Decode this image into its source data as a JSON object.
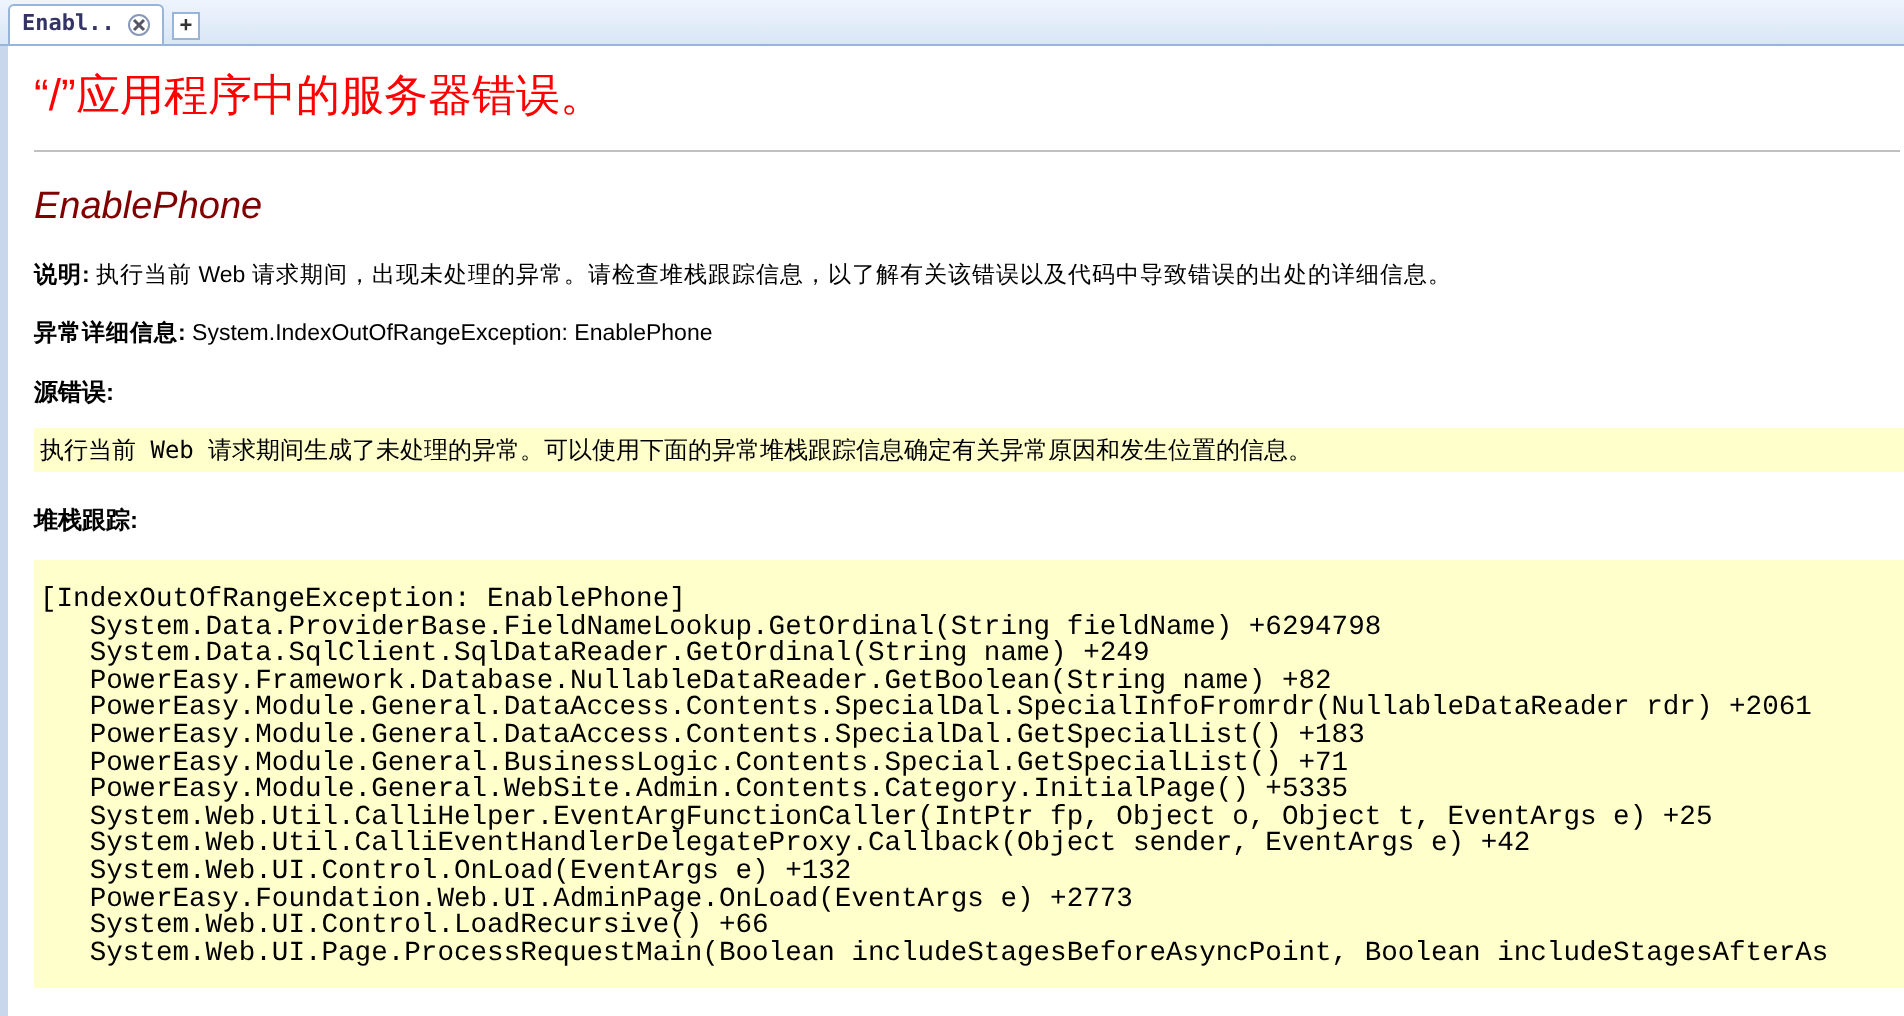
{
  "tabs": [
    {
      "label": "Enabl..",
      "selected": true
    }
  ],
  "new_tab": "+",
  "title": "“/”应用程序中的服务器错误。",
  "error_name": "EnablePhone",
  "description": {
    "label": "说明:",
    "text": "执行当前 Web 请求期间，出现未处理的异常。请检查堆栈跟踪信息，以了解有关该错误以及代码中导致错误的出处的详细信息。"
  },
  "exception_details": {
    "label": "异常详细信息:",
    "text": "System.IndexOutOfRangeException: EnablePhone"
  },
  "source_error": {
    "label": "源错误:",
    "text": "执行当前 Web 请求期间生成了未处理的异常。可以使用下面的异常堆栈跟踪信息确定有关异常原因和发生位置的信息。"
  },
  "stack_trace": {
    "label": "堆栈跟踪:",
    "lines": [
      "[IndexOutOfRangeException: EnablePhone]",
      "   System.Data.ProviderBase.FieldNameLookup.GetOrdinal(String fieldName) +6294798",
      "   System.Data.SqlClient.SqlDataReader.GetOrdinal(String name) +249",
      "   PowerEasy.Framework.Database.NullableDataReader.GetBoolean(String name) +82",
      "   PowerEasy.Module.General.DataAccess.Contents.SpecialDal.SpecialInfoFromrdr(NullableDataReader rdr) +2061",
      "   PowerEasy.Module.General.DataAccess.Contents.SpecialDal.GetSpecialList() +183",
      "   PowerEasy.Module.General.BusinessLogic.Contents.Special.GetSpecialList() +71",
      "   PowerEasy.Module.General.WebSite.Admin.Contents.Category.InitialPage() +5335",
      "   System.Web.Util.CalliHelper.EventArgFunctionCaller(IntPtr fp, Object o, Object t, EventArgs e) +25",
      "   System.Web.Util.CalliEventHandlerDelegateProxy.Callback(Object sender, EventArgs e) +42",
      "   System.Web.UI.Control.OnLoad(EventArgs e) +132",
      "   PowerEasy.Foundation.Web.UI.AdminPage.OnLoad(EventArgs e) +2773",
      "   System.Web.UI.Control.LoadRecursive() +66",
      "   System.Web.UI.Page.ProcessRequestMain(Boolean includeStagesBeforeAsyncPoint, Boolean includeStagesAfterAs"
    ]
  }
}
